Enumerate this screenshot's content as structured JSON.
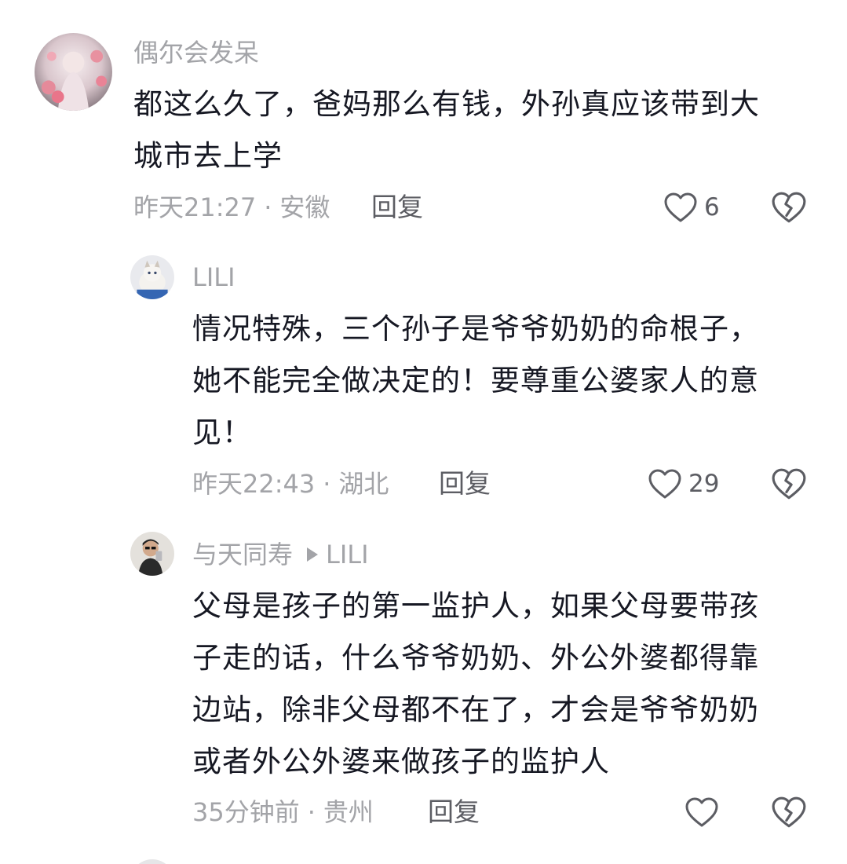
{
  "comments": [
    {
      "username": "偶尔会发呆",
      "text_lines": [
        "都这么久了，爸妈那么有钱，外孙真应该带到大",
        "城市去上学"
      ],
      "time": "昨天21:27",
      "location": "安徽",
      "reply_label": "回复",
      "likes": "6"
    },
    {
      "username": "LILI",
      "text_lines": [
        "情况特殊，三个孙子是爷爷奶奶的命根子，",
        "她不能完全做决定的！要尊重公婆家人的意",
        "见！"
      ],
      "time": "昨天22:43",
      "location": "湖北",
      "reply_label": "回复",
      "likes": "29"
    },
    {
      "username": "与天同寿",
      "reply_to": "LILI",
      "text_lines": [
        "父母是孩子的第一监护人，如果父母要带孩",
        "子走的话，什么爷爷奶奶、外公外婆都得靠",
        "边站，除非父母都不在了，才会是爷爷奶奶",
        "或者外公外婆来做孩子的监护人"
      ],
      "time": "35分钟前",
      "location": "贵州",
      "reply_label": "回复",
      "likes": ""
    }
  ],
  "separator_dot": "·",
  "colors": {
    "text": "#161823",
    "muted": "#a3a4a8",
    "action": "#5c5d63"
  },
  "icons": {
    "like": "heart-outline-icon",
    "dislike": "broken-heart-icon"
  }
}
